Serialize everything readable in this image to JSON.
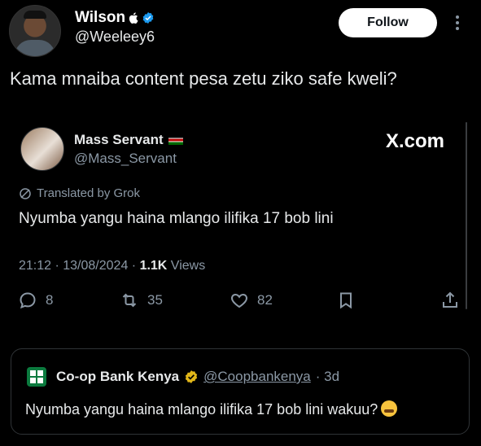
{
  "header": {
    "name": "Wilson",
    "name_badge_icon": "apple-logo-icon",
    "handle": "@Weeleey6",
    "follow_label": "Follow",
    "tweet_text": "Kama mnaiba content pesa zetu ziko safe kweli?"
  },
  "card": {
    "name": "Mass Servant",
    "handle": "@Mass_Servant",
    "site_label": "X.com",
    "translated_label": "Translated by Grok",
    "text": "Nyumba yangu haina mlango ilifika 17 bob lini",
    "timestamp": "21:12 · 13/08/2024 · ",
    "views_count": "1.1K",
    "views_label": " Views",
    "actions": {
      "replies": "8",
      "reposts": "35",
      "likes": "82"
    }
  },
  "quote": {
    "name": "Co-op Bank Kenya",
    "handle": "@Coopbankenya",
    "age": "· 3d",
    "text": "Nyumba yangu haina mlango ilifika 17 bob lini wakuu?"
  },
  "colors": {
    "background": "#000000",
    "verified_blue": "#1d9bf0",
    "verified_gold": "#e2b719",
    "muted": "#8b98a5"
  }
}
